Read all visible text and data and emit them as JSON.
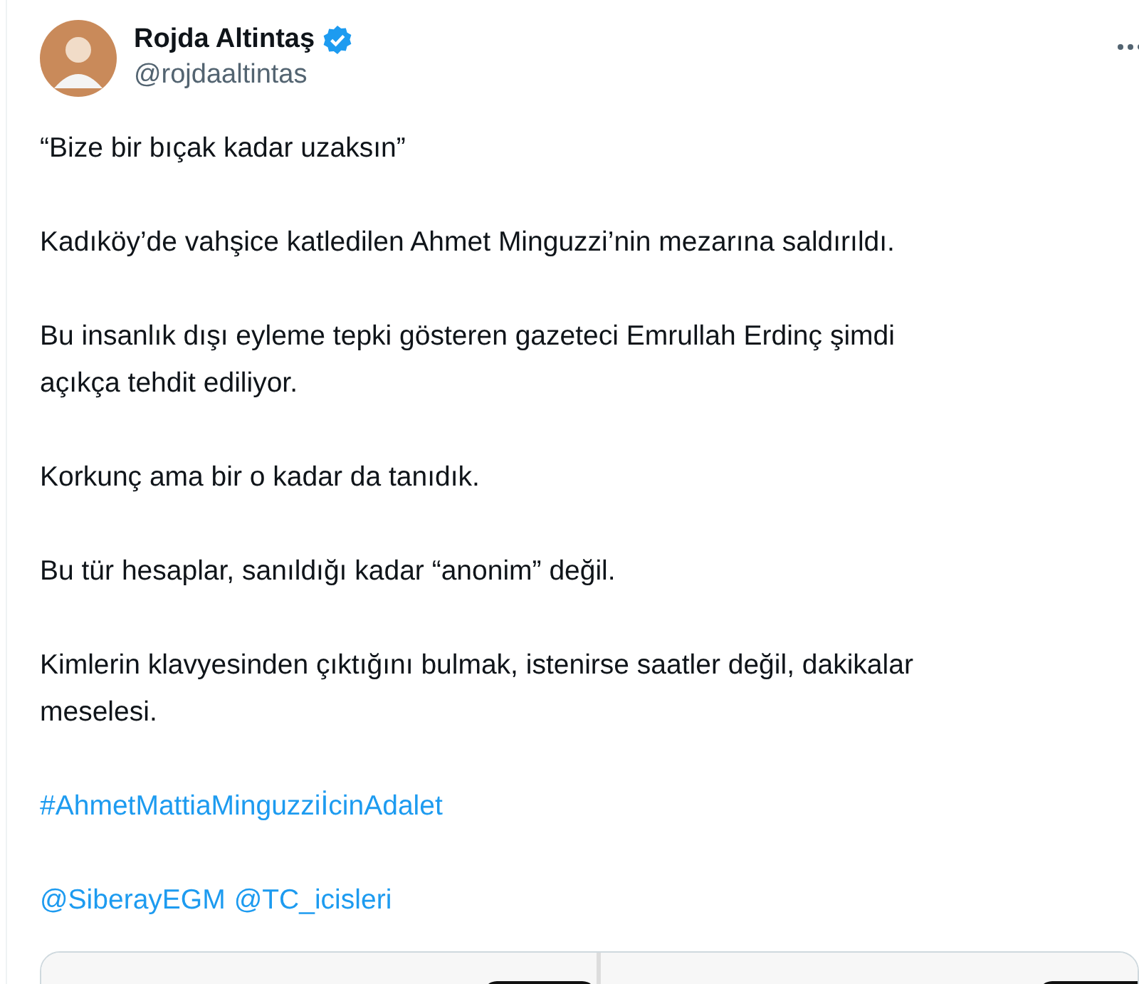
{
  "author": {
    "name": "Rojda Altintaş",
    "verified": true,
    "handle": "@rojdaaltintas"
  },
  "paragraphs": [
    {
      "kind": "text",
      "lines": [
        "“Bize bir bıçak kadar uzaksın”"
      ]
    },
    {
      "kind": "text",
      "lines": [
        "Kadıköy’de vahşice katledilen Ahmet Minguzzi’nin mezarına saldırıldı."
      ]
    },
    {
      "kind": "text",
      "lines": [
        "Bu insanlık dışı eyleme tepki gösteren gazeteci Emrullah Erdinç şimdi",
        "açıkça tehdit ediliyor."
      ]
    },
    {
      "kind": "text",
      "lines": [
        "Korkunç ama bir o kadar da tanıdık."
      ]
    },
    {
      "kind": "text",
      "lines": [
        "Bu tür hesaplar, sanıldığı kadar “anonim” değil."
      ]
    },
    {
      "kind": "text",
      "lines": [
        "Kimlerin klavyesinden çıktığını bulmak, istenirse saatler değil, dakikalar",
        "meselesi."
      ]
    },
    {
      "kind": "links",
      "lines": [
        "#AhmetMattiaMinguzziİcinAdalet"
      ]
    },
    {
      "kind": "links",
      "lines": [
        "@SiberayEGM",
        "@TC_icisleri"
      ]
    }
  ]
}
